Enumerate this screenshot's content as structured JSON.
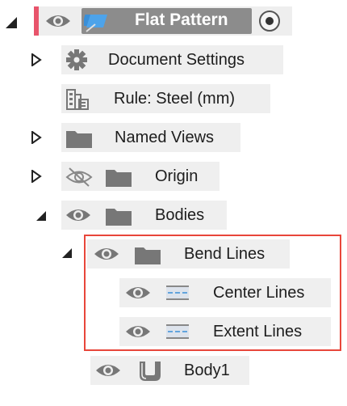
{
  "colors": {
    "active_marker": "#e8546b",
    "selection_box": "#e8463a",
    "row_bg": "#efefef",
    "icon_gray": "#777777",
    "root_block": "#8c8c8c"
  },
  "tree": {
    "root": {
      "label": "Flat Pattern",
      "expanded": true,
      "icon": "flat-pattern-icon"
    },
    "document_settings": {
      "label": "Document Settings",
      "icon": "gear-icon",
      "expanded": false
    },
    "rule": {
      "label": "Rule: Steel (mm)",
      "icon": "rule-icon"
    },
    "named_views": {
      "label": "Named Views",
      "icon": "folder-icon",
      "expanded": false
    },
    "origin": {
      "label": "Origin",
      "icon": "folder-icon",
      "visible": false,
      "expanded": false
    },
    "bodies": {
      "label": "Bodies",
      "icon": "folder-icon",
      "visible": true,
      "expanded": true
    },
    "bend_lines": {
      "label": "Bend Lines",
      "icon": "folder-icon",
      "visible": true,
      "expanded": true
    },
    "center_lines": {
      "label": "Center Lines",
      "icon": "lines-icon",
      "visible": true
    },
    "extent_lines": {
      "label": "Extent Lines",
      "icon": "lines-icon",
      "visible": true
    },
    "body1": {
      "label": "Body1",
      "icon": "sheet-body-icon",
      "visible": true
    }
  }
}
